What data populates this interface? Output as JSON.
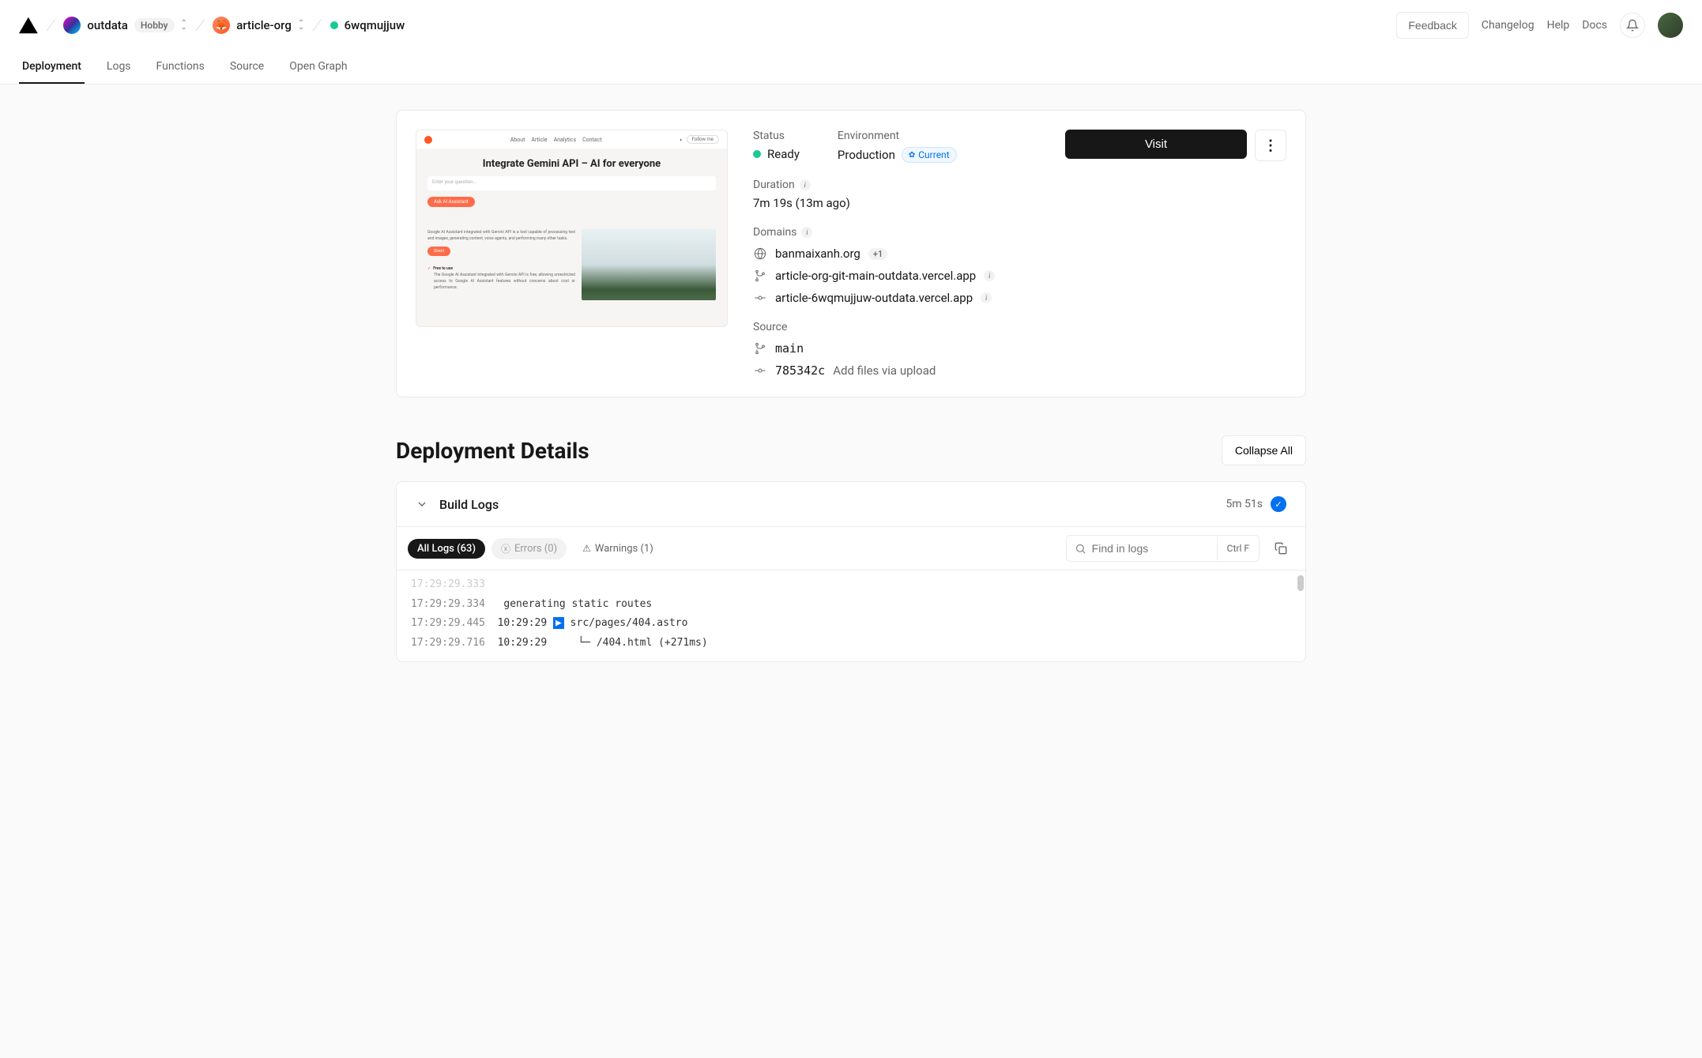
{
  "breadcrumbs": {
    "team": "outdata",
    "plan": "Hobby",
    "project": "article-org",
    "deployment": "6wqmujjuw"
  },
  "header_links": {
    "feedback": "Feedback",
    "changelog": "Changelog",
    "help": "Help",
    "docs": "Docs"
  },
  "tabs": [
    "Deployment",
    "Logs",
    "Functions",
    "Source",
    "Open Graph"
  ],
  "overview": {
    "status_label": "Status",
    "status_value": "Ready",
    "env_label": "Environment",
    "env_value": "Production",
    "current_badge": "Current",
    "duration_label": "Duration",
    "duration_value": "7m 19s (13m ago)",
    "domains_label": "Domains",
    "domains": [
      {
        "icon": "globe",
        "text": "banmaixanh.org",
        "extra": "+1"
      },
      {
        "icon": "branch",
        "text": "article-org-git-main-outdata.vercel.app",
        "info": true
      },
      {
        "icon": "commit",
        "text": "article-6wqmujjuw-outdata.vercel.app",
        "info": true
      }
    ],
    "source_label": "Source",
    "branch": "main",
    "commit_sha": "785342c",
    "commit_msg": "Add files via upload",
    "visit_button": "Visit"
  },
  "preview": {
    "nav": [
      "About",
      "Article",
      "Analytics",
      "Contact"
    ],
    "follow": "Follow me",
    "title": "Integrate Gemini API – AI for everyone",
    "placeholder": "Enter your question…",
    "ask_btn": "Ask AI Assistant",
    "blurb": "Google AI Assistant integrated with Gemini API is a tool capable of processing text and images, generating content, voice agents, and performing many other tasks.",
    "direct": "Direct",
    "free_title": "Free to use",
    "free_text": "The Google AI Assistant integrated with Gemini API is free, allowing unrestricted access to Google AI Assistant features without concerns about cost or performance."
  },
  "details": {
    "title": "Deployment Details",
    "collapse": "Collapse All"
  },
  "build_logs": {
    "title": "Build Logs",
    "duration": "5m 51s",
    "filters": {
      "all": "All Logs (63)",
      "errors": "Errors (0)",
      "warnings": "Warnings (1)"
    },
    "search_placeholder": "Find in logs",
    "shortcut": "Ctrl F",
    "lines": [
      {
        "ts": "17:29:29.333",
        "faded": true,
        "rest": ""
      },
      {
        "ts": "17:29:29.334",
        "rest": "   generating static routes"
      },
      {
        "ts": "17:29:29.445",
        "t2": "10:29:29",
        "box": "▶",
        "rest": " src/pages/404.astro"
      },
      {
        "ts": "17:29:29.716",
        "t2": "10:29:29",
        "tree": "  └─ ",
        "rest": "/404.html (+271ms)"
      }
    ]
  }
}
